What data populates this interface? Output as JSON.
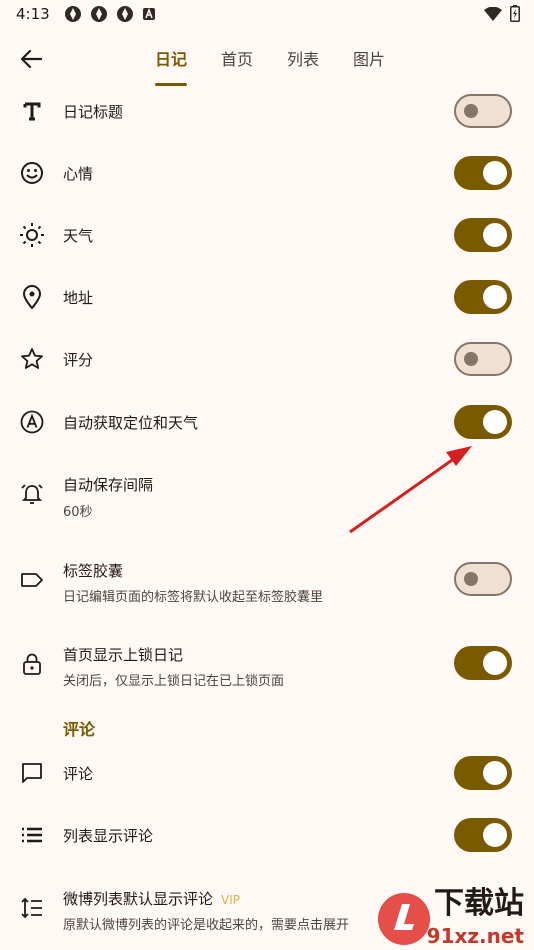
{
  "status_bar": {
    "time": "4:13"
  },
  "tabs": [
    {
      "label": "日记",
      "active": true
    },
    {
      "label": "首页",
      "active": false
    },
    {
      "label": "列表",
      "active": false
    },
    {
      "label": "图片",
      "active": false
    }
  ],
  "settings": [
    {
      "title": "日记标题",
      "subtitle": "",
      "on": false,
      "icon": "title-icon"
    },
    {
      "title": "心情",
      "subtitle": "",
      "on": true,
      "icon": "smiley-icon"
    },
    {
      "title": "天气",
      "subtitle": "",
      "on": true,
      "icon": "sun-icon"
    },
    {
      "title": "地址",
      "subtitle": "",
      "on": true,
      "icon": "location-pin-icon"
    },
    {
      "title": "评分",
      "subtitle": "",
      "on": false,
      "icon": "star-icon"
    },
    {
      "title": "自动获取定位和天气",
      "subtitle": "",
      "on": true,
      "icon": "auto-a-icon"
    },
    {
      "title": "自动保存间隔",
      "subtitle": "60秒",
      "icon": "alarm-icon"
    },
    {
      "title": "标签胶囊",
      "subtitle": "日记编辑页面的标签将默认收起至标签胶囊里",
      "on": false,
      "icon": "label-icon"
    },
    {
      "title": "首页显示上锁日记",
      "subtitle": "关闭后，仅显示上锁日记在已上锁页面",
      "on": true,
      "icon": "lock-icon"
    }
  ],
  "section_comment": "评论",
  "comment_settings": [
    {
      "title": "评论",
      "subtitle": "",
      "on": true,
      "icon": "comment-icon"
    },
    {
      "title": "列表显示评论",
      "subtitle": "",
      "on": true,
      "icon": "list-icon"
    },
    {
      "title": "微博列表默认显示评论",
      "badge": "VIP",
      "subtitle": "原默认微博列表的评论是收起来的，需要点击展开",
      "icon": "line-spacing-icon"
    }
  ],
  "watermark": {
    "text": "下载站",
    "url": "91xz.net"
  },
  "colors": {
    "accent": "#7a5a00",
    "background": "#fff8f4",
    "switch_off": "#efe0d3",
    "arrow": "#d42020"
  }
}
